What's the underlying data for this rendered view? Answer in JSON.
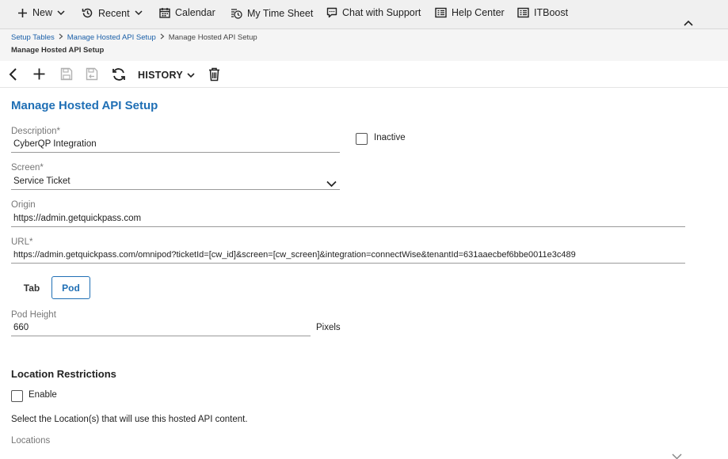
{
  "nav": {
    "new_label": "New",
    "recent_label": "Recent",
    "calendar_label": "Calendar",
    "timesheet_label": "My Time Sheet",
    "chat_label": "Chat with Support",
    "help_label": "Help Center",
    "itboost_label": "ITBoost"
  },
  "breadcrumb": {
    "items": [
      "Setup Tables",
      "Manage Hosted API Setup"
    ],
    "current": "Manage Hosted API Setup"
  },
  "page_subtitle": "Manage Hosted API Setup",
  "toolbar": {
    "history_label": "HISTORY"
  },
  "form": {
    "title": "Manage Hosted API Setup",
    "description_label": "Description*",
    "description_value": "CyberQP Integration",
    "inactive_label": "Inactive",
    "screen_label": "Screen*",
    "screen_value": "Service Ticket",
    "origin_label": "Origin",
    "origin_value": "https://admin.getquickpass.com",
    "url_label": "URL*",
    "url_value": "https://admin.getquickpass.com/omnipod?ticketId=[cw_id]&screen=[cw_screen]&integration=connectWise&tenantId=631aaecbef6bbe0011e3c489",
    "tab_label": "Tab",
    "pod_label": "Pod",
    "pod_height_label": "Pod Height",
    "pod_height_value": "660",
    "pixels_label": "Pixels"
  },
  "location": {
    "heading": "Location Restrictions",
    "enable_label": "Enable",
    "info": "Select the Location(s) that will use this hosted API content.",
    "locations_label": "Locations"
  },
  "colors": {
    "accent": "#1f6fb5",
    "link": "#1a5fa8"
  }
}
